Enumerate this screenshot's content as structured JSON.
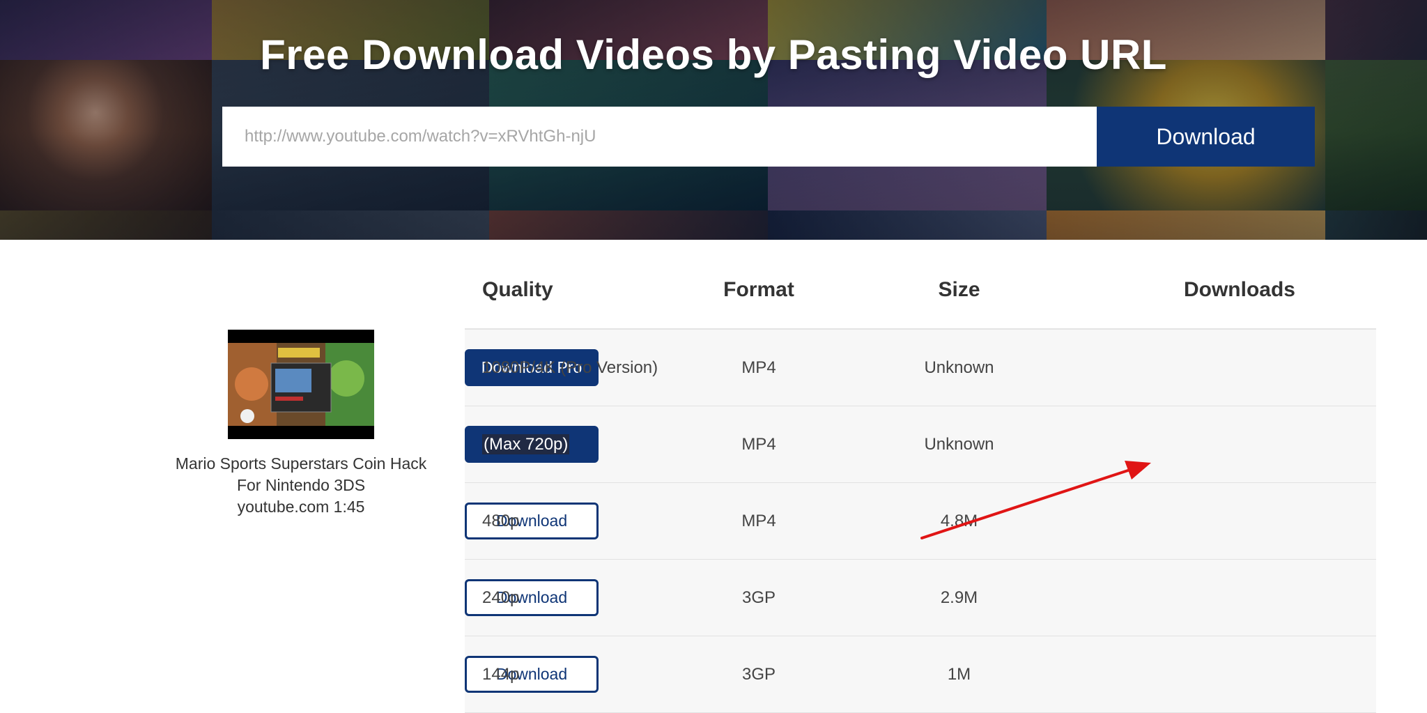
{
  "hero": {
    "title": "Free Download Videos by Pasting Video URL",
    "url_placeholder": "http://www.youtube.com/watch?v=xRVhtGh-njU",
    "download_label": "Download"
  },
  "video": {
    "title_line1": "Mario Sports Superstars Coin Hack",
    "title_line2": "For Nintendo 3DS",
    "meta": "youtube.com 1:45"
  },
  "table": {
    "headers": {
      "quality": "Quality",
      "format": "Format",
      "size": "Size",
      "downloads": "Downloads"
    },
    "rows": [
      {
        "quality": "1080P/4K (Pro Version)",
        "format": "MP4",
        "size": "Unknown",
        "button": "Download Pro",
        "style": "filled"
      },
      {
        "quality": "(Max 720p)",
        "format": "MP4",
        "size": "Unknown",
        "button": "Download",
        "style": "filled",
        "highlighted": true
      },
      {
        "quality": "480p",
        "format": "MP4",
        "size": "4.8M",
        "button": "Download",
        "style": "outline"
      },
      {
        "quality": "240p",
        "format": "3GP",
        "size": "2.9M",
        "button": "Download",
        "style": "outline"
      },
      {
        "quality": "144p",
        "format": "3GP",
        "size": "1M",
        "button": "Download",
        "style": "outline"
      }
    ]
  },
  "colors": {
    "brand": "#0f3576",
    "annotation": "#e01515"
  }
}
